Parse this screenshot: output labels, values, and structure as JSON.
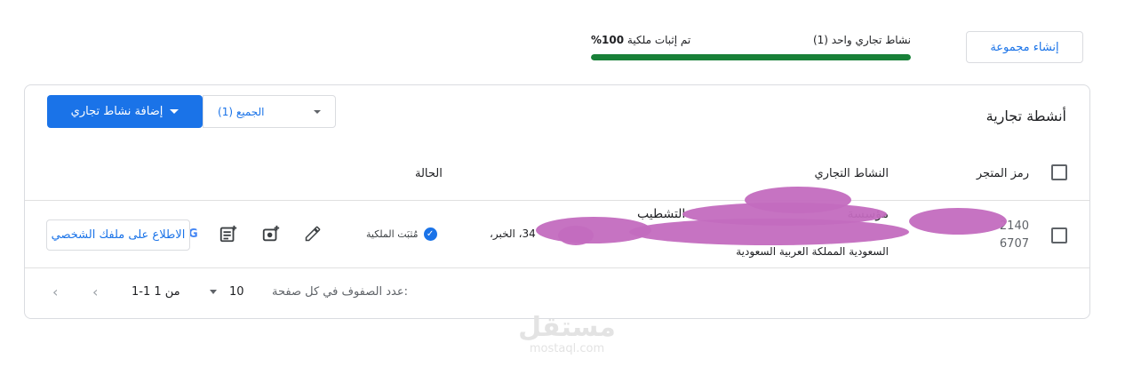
{
  "header": {
    "create_group_label": "إنشاء مجموعة",
    "business_count_label": "نشاط تجاري واحد (1)",
    "verification_label": "تم إثبات ملكية",
    "verification_percent": "100%",
    "progress_fraction": 1.0,
    "progress_color": "#188038"
  },
  "card": {
    "title": "أنشطة تجارية",
    "add_button_label": "إضافة نشاط تجاري",
    "filter_label": "الجميع (1)"
  },
  "table": {
    "columns": {
      "store_code": "رمز المتجر",
      "business": "النشاط التجاري",
      "status": "الحالة"
    },
    "rows": [
      {
        "store_code_line1": "2140",
        "store_code_line2": "6707",
        "business_name": "مؤسسة",
        "business_name_fragment": "التشطيب",
        "address_line1": "34، الخبر،",
        "address_line2": "السعودية المملكة العربية السعودية",
        "status": "مُثبَت الملكية",
        "status_icon": "verified-check-icon",
        "profile_button_label": "الاطلاع على ملفك الشخصي",
        "profile_button_icon": "google-g-icon",
        "actions": [
          "edit-pencil-icon",
          "add-photo-icon",
          "add-post-icon"
        ]
      }
    ]
  },
  "pagination": {
    "rows_per_page_label": "عدد الصفوف في كل صفحة:",
    "rows_per_page_value": "10",
    "range_label": "1-1 من 1"
  },
  "watermark": {
    "arabic": "مستقل",
    "latin": "mostaql.com"
  },
  "colors": {
    "accent": "#1a73e8",
    "success": "#188038",
    "redaction": "#c36bbf"
  }
}
